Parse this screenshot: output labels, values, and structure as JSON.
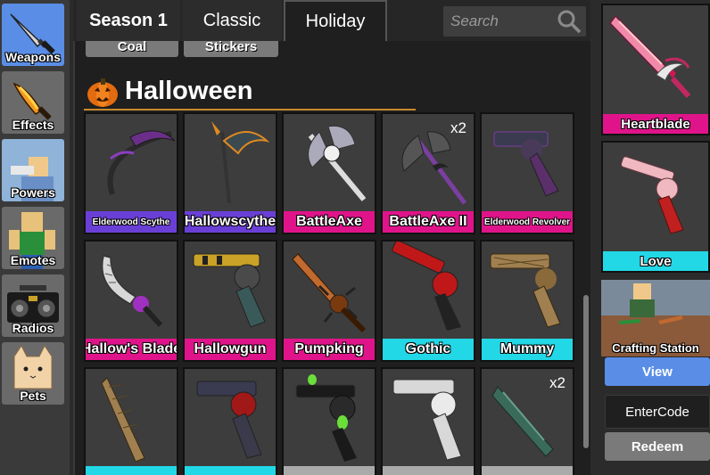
{
  "sidebar": {
    "items": [
      {
        "label": "Weapons",
        "icon": "knife-icon",
        "active": true
      },
      {
        "label": "Effects",
        "icon": "flame-knife-icon",
        "active": false
      },
      {
        "label": "Powers",
        "icon": "power-avatar-icon",
        "active": false
      },
      {
        "label": "Emotes",
        "icon": "emote-avatar-icon",
        "active": false
      },
      {
        "label": "Radios",
        "icon": "radio-icon",
        "active": false
      },
      {
        "label": "Pets",
        "icon": "cat-icon",
        "active": false
      }
    ]
  },
  "tabs": [
    {
      "label": "Season 1",
      "active": false
    },
    {
      "label": "Classic",
      "active": false
    },
    {
      "label": "Holiday",
      "active": true
    }
  ],
  "search": {
    "placeholder": "Search"
  },
  "subtabs": [
    "Coal",
    "Stickers"
  ],
  "section": {
    "title": "Halloween",
    "icon": "pumpkin-icon"
  },
  "items": [
    {
      "name": "Elderwood Scythe",
      "color": "#6a3fd6",
      "qty": ""
    },
    {
      "name": "Hallowscythe",
      "color": "#6a3fd6",
      "qty": ""
    },
    {
      "name": "BattleAxe",
      "color": "#e0148a",
      "qty": ""
    },
    {
      "name": "BattleAxe II",
      "color": "#e0148a",
      "qty": "x2"
    },
    {
      "name": "Elderwood Revolver",
      "color": "#e0148a",
      "qty": ""
    },
    {
      "name": "Hallow's Blade",
      "color": "#e0148a",
      "qty": ""
    },
    {
      "name": "Hallowgun",
      "color": "#e0148a",
      "qty": ""
    },
    {
      "name": "Pumpking",
      "color": "#e0148a",
      "qty": ""
    },
    {
      "name": "Gothic",
      "color": "#22d8e6",
      "qty": ""
    },
    {
      "name": "Mummy",
      "color": "#22d8e6",
      "qty": ""
    },
    {
      "name": "",
      "color": "#22d8e6",
      "qty": ""
    },
    {
      "name": "",
      "color": "#22d8e6",
      "qty": ""
    },
    {
      "name": "",
      "color": "#aaaaaa",
      "qty": ""
    },
    {
      "name": "",
      "color": "#aaaaaa",
      "qty": ""
    },
    {
      "name": "",
      "color": "#aaaaaa",
      "qty": "x2"
    }
  ],
  "right_panel": {
    "equipped_knife": {
      "name": "Heartblade",
      "color": "#e0148a"
    },
    "equipped_gun": {
      "name": "Love",
      "color": "#22d8e6"
    },
    "crafting": {
      "title": "Crafting Station",
      "button": "View"
    },
    "entercode": {
      "label": "EnterCode"
    },
    "redeem": {
      "label": "Redeem"
    }
  }
}
